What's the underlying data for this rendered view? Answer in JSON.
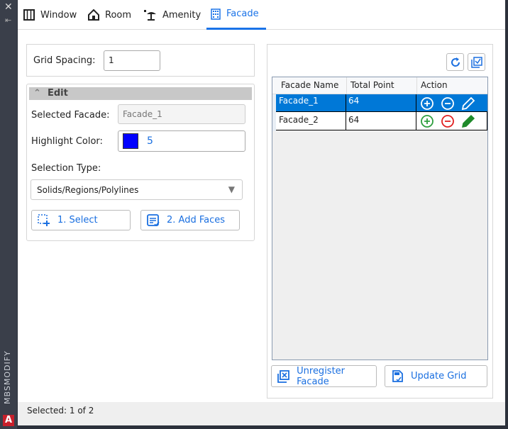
{
  "sidebar": {
    "close": "✕",
    "pin": "⇤",
    "title": "MBSMODIFY",
    "logo": "A"
  },
  "tabs": [
    {
      "label": "Window",
      "icon": "window-icon"
    },
    {
      "label": "Room",
      "icon": "house-icon"
    },
    {
      "label": "Amenity",
      "icon": "umbrella-icon"
    },
    {
      "label": "Facade",
      "icon": "building-icon",
      "active": true
    }
  ],
  "grid_spacing": {
    "label": "Grid Spacing:",
    "value": "1"
  },
  "edit": {
    "header": "Edit",
    "selected_facade_label": "Selected Facade:",
    "selected_facade_value": "Facade_1",
    "highlight_color_label": "Highlight Color:",
    "highlight_color_value": "5",
    "highlight_color_swatch": "#0000ff",
    "selection_type_label": "Selection Type:",
    "selection_type_value": "Solids/Regions/Polylines",
    "select_button": "1. Select",
    "add_faces_button": "2. Add Faces"
  },
  "table": {
    "columns": [
      "Facade Name",
      "Total Point",
      "Action"
    ],
    "rows": [
      {
        "name": "Facade_1",
        "points": "64",
        "selected": true
      },
      {
        "name": "Facade_2",
        "points": "64",
        "selected": false
      }
    ]
  },
  "buttons": {
    "unregister": "Unregister Facade",
    "update_grid": "Update Grid"
  },
  "status": "Selected: 1 of 2",
  "colors": {
    "accent": "#1a73e8",
    "selection": "#0078d7",
    "add": "#2e9e3e",
    "remove": "#e02020",
    "edit": "#1f8a2a"
  }
}
